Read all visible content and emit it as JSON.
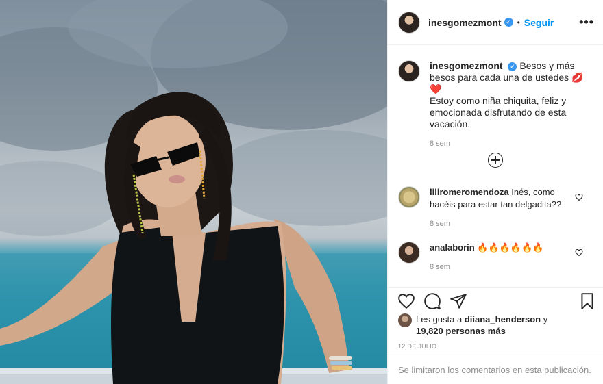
{
  "post": {
    "account": {
      "username": "inesgomezmont",
      "verified_icon": "verified-badge-icon",
      "dot": "•",
      "follow_label": "Seguir",
      "more_label": "•••"
    },
    "caption": {
      "username": "inesgomezmont",
      "text_line1": "Besos y más besos para cada una de ustedes 💋❤️",
      "text_line2": "Estoy como niña chiquita, feliz y emocionada disfrutando de esta vacación.",
      "time": "8 sem"
    },
    "load_more_icon": "plus-circle-icon",
    "comments": [
      {
        "username": "liliromeromendoza",
        "text": "Inés, como hacéis para estar tan delgadita??",
        "time": "8 sem",
        "like_icon": "heart-outline-icon"
      },
      {
        "username": "analaborin",
        "text": "🔥🔥🔥🔥🔥🔥",
        "time": "8 sem",
        "like_icon": "heart-outline-icon"
      }
    ],
    "actions": {
      "like_icon": "heart-outline-icon",
      "comment_icon": "comment-bubble-icon",
      "share_icon": "paper-plane-icon",
      "save_icon": "bookmark-icon"
    },
    "likes": {
      "prefix": "Les gusta a",
      "user": "diiana_henderson",
      "joiner": "y",
      "count": "19,820 personas más"
    },
    "date": "12 DE JULIO",
    "comments_limited": "Se limitaron los comentarios en esta publicación."
  },
  "colors": {
    "accent": "#0095f6",
    "text": "#262626",
    "muted": "#8e8e8e",
    "border": "#efefef",
    "verified": "#3897f0"
  }
}
